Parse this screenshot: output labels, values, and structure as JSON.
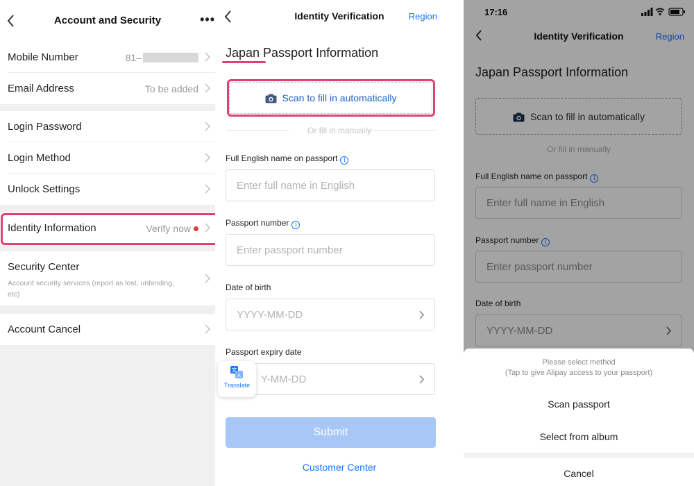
{
  "account_screen": {
    "title": "Account and Security",
    "more": "•••",
    "rows": [
      {
        "label": "Mobile Number",
        "value": "81–"
      },
      {
        "label": "Email Address",
        "value": "To be added"
      },
      {
        "label": "Login Password"
      },
      {
        "label": "Login Method"
      },
      {
        "label": "Unlock Settings"
      },
      {
        "label": "Identity Information",
        "value": "Verify now"
      },
      {
        "label": "Security Center",
        "subtext": "Account security services (report as lost, unbinding, etc)"
      },
      {
        "label": "Account Cancel"
      }
    ]
  },
  "verify_screen": {
    "nav_title": "Identity Verification",
    "region": "Region",
    "heading": "Japan Passport Information",
    "scan_label": "Scan to fill in automatically",
    "or_text": "Or fill in manually",
    "fields": [
      {
        "label": "Full English name on passport",
        "placeholder": "Enter full name in English"
      },
      {
        "label": "Passport number",
        "placeholder": "Enter passport number"
      },
      {
        "label": "Date of birth",
        "placeholder": "YYYY-MM-DD"
      },
      {
        "label": "Passport expiry date",
        "placeholder": "Y-MM-DD"
      }
    ],
    "translate_label": "Translate",
    "submit": "Submit",
    "customer_center": "Customer Center"
  },
  "method_screen": {
    "status_time": "17:16",
    "nav_title": "Identity Verification",
    "region": "Region",
    "heading": "Japan Passport Information",
    "scan_label": "Scan to fill in automatically",
    "or_text": "Or fill in manually",
    "fields": [
      {
        "label": "Full English name on passport",
        "placeholder": "Enter full name in English"
      },
      {
        "label": "Passport number",
        "placeholder": "Enter passport number"
      },
      {
        "label": "Date of birth",
        "placeholder": "YYYY-MM-DD"
      }
    ],
    "sheet": {
      "title": "Please select method",
      "subtitle": "(Tap to give Alipay access to your passport)",
      "option_scan": "Scan passport",
      "option_album": "Select from album",
      "cancel": "Cancel"
    }
  },
  "colors": {
    "accent": "#1677ff",
    "highlight": "#e0407a",
    "badge": "#e53935",
    "submit_disabled": "#a7c8f7"
  },
  "icons": [
    "back-arrow-icon",
    "more-icon",
    "chevron-right-icon",
    "camera-icon",
    "info-icon",
    "translate-icon",
    "signal-icon",
    "wifi-icon",
    "battery-icon"
  ]
}
